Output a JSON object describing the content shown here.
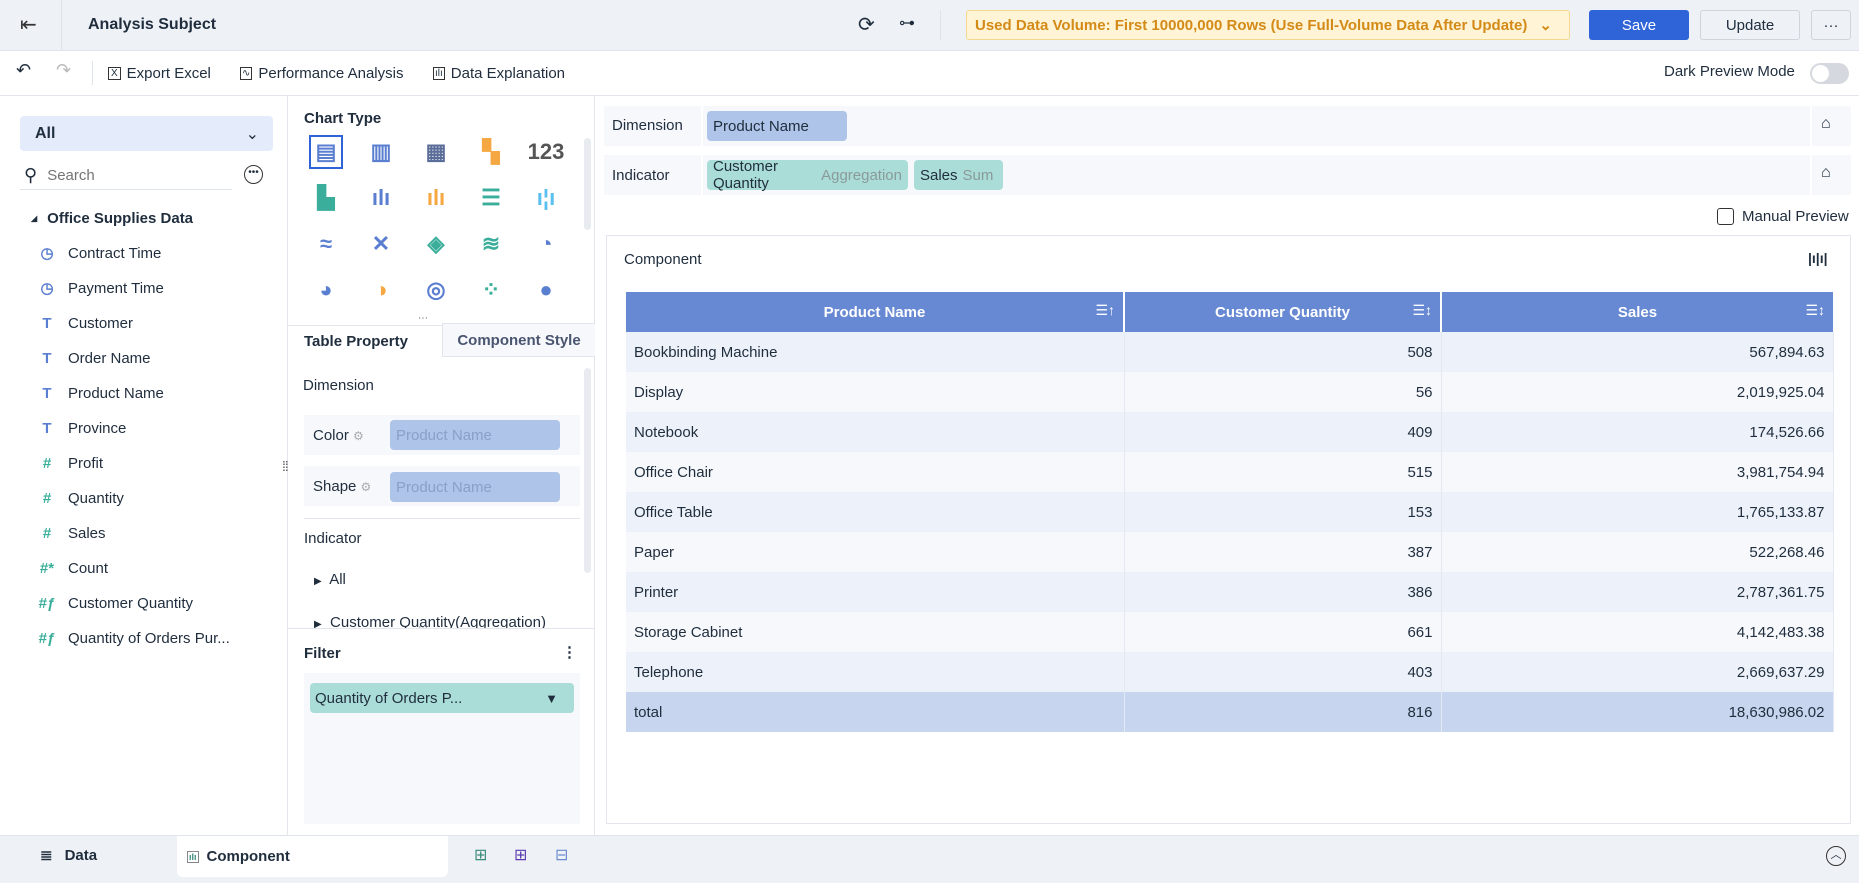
{
  "header": {
    "title": "Analysis Subject",
    "data_volume": "Used Data Volume: First 10000,000 Rows (Use Full-Volume Data After Update)",
    "save": "Save",
    "update": "Update",
    "more": "···"
  },
  "toolbar": {
    "export_excel": "Export Excel",
    "performance_analysis": "Performance Analysis",
    "data_explanation": "Data Explanation",
    "dark_preview": "Dark Preview Mode"
  },
  "left": {
    "dropdown": "All",
    "search_placeholder": "Search",
    "group": "Office Supplies Data",
    "fields": [
      {
        "label": "Contract Time",
        "type": "date"
      },
      {
        "label": "Payment Time",
        "type": "date"
      },
      {
        "label": "Customer",
        "type": "text"
      },
      {
        "label": "Order Name",
        "type": "text"
      },
      {
        "label": "Product Name",
        "type": "text"
      },
      {
        "label": "Province",
        "type": "text"
      },
      {
        "label": "Profit",
        "type": "number"
      },
      {
        "label": "Quantity",
        "type": "number"
      },
      {
        "label": "Sales",
        "type": "number"
      },
      {
        "label": "Count",
        "type": "count"
      },
      {
        "label": "Customer Quantity",
        "type": "calc"
      },
      {
        "label": "Quantity of Orders Pur...",
        "type": "calc"
      }
    ]
  },
  "middle": {
    "chart_type_title": "Chart Type",
    "tab_table_property": "Table Property",
    "tab_component_style": "Component Style",
    "dimension_title": "Dimension",
    "color_label": "Color",
    "shape_label": "Shape",
    "color_value": "Product Name",
    "shape_value": "Product Name",
    "indicator_title": "Indicator",
    "indicator_items": [
      "All",
      "Customer Quantity(Aggregation)"
    ],
    "filter_title": "Filter",
    "filter_chip": "Quantity of Orders P..."
  },
  "right": {
    "dimension_label": "Dimension",
    "dimension_chip": "Product Name",
    "indicator_label": "Indicator",
    "indicator_chips": [
      {
        "name": "Customer Quantity",
        "agg": "Aggregation"
      },
      {
        "name": "Sales",
        "agg": "Sum"
      }
    ],
    "manual_preview": "Manual Preview",
    "component_title": "Component",
    "table": {
      "headers": [
        "Product Name",
        "Customer Quantity",
        "Sales"
      ],
      "rows": [
        [
          "Bookbinding Machine",
          "508",
          "567,894.63"
        ],
        [
          "Display",
          "56",
          "2,019,925.04"
        ],
        [
          "Notebook",
          "409",
          "174,526.66"
        ],
        [
          "Office Chair",
          "515",
          "3,981,754.94"
        ],
        [
          "Office Table",
          "153",
          "1,765,133.87"
        ],
        [
          "Paper",
          "387",
          "522,268.46"
        ],
        [
          "Printer",
          "386",
          "2,787,361.75"
        ],
        [
          "Storage Cabinet",
          "661",
          "4,142,483.38"
        ],
        [
          "Telephone",
          "403",
          "2,669,637.29"
        ]
      ],
      "total": [
        "total",
        "816",
        "18,630,986.02"
      ]
    }
  },
  "bottom": {
    "data_tab": "Data",
    "component_tab": "Component"
  },
  "colors": {
    "primary": "#2f64d8",
    "header": "#6788d2",
    "dim_chip": "#aec4e8",
    "ind_chip": "#abddd8",
    "warning_bg": "#fff4d6",
    "warning_text": "#d48a17"
  }
}
